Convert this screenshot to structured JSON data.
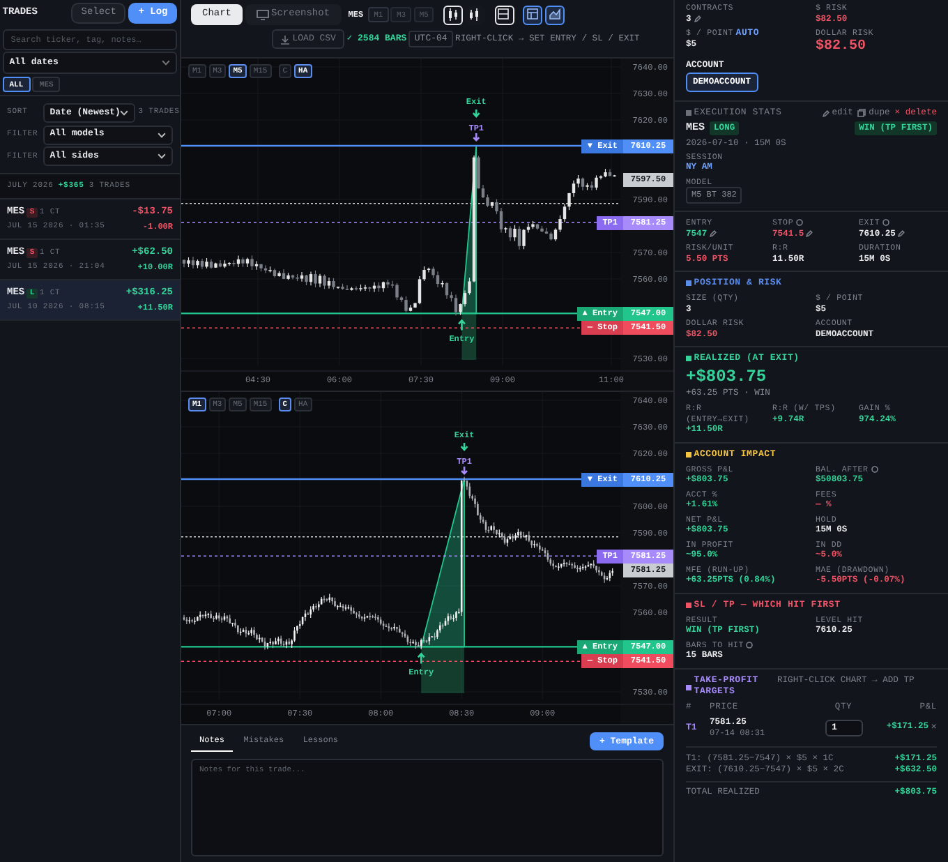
{
  "sidebar": {
    "title": "TRADES",
    "select_button": "Select",
    "log_button": "+ Log",
    "search": {
      "placeholder": "Search ticker, tag, notes…"
    },
    "date_filter": "All dates",
    "symbol_chips": [
      {
        "label": "ALL",
        "selected": true
      },
      {
        "label": "MES",
        "selected": false
      }
    ],
    "sort": {
      "label": "SORT",
      "value": "Date (Newest)",
      "count": "3 TRADES"
    },
    "filters": [
      {
        "label": "FILTER",
        "value": "All models"
      },
      {
        "label": "FILTER",
        "value": "All sides"
      }
    ],
    "group": {
      "month": "JULY 2026",
      "pnl": "+$365",
      "count": "3 TRADES"
    },
    "trades": [
      {
        "symbol": "MES",
        "side": "S",
        "kind": "short",
        "size": "1 CT",
        "pnl": "-$13.75",
        "date": "JUL 15 2026 · 01:35",
        "r": "-1.00R",
        "profit": false,
        "selected": false
      },
      {
        "symbol": "MES",
        "side": "S",
        "kind": "short",
        "size": "1 CT",
        "pnl": "+$62.50",
        "date": "JUL 15 2026 · 21:04",
        "r": "+10.00R",
        "profit": true,
        "selected": false
      },
      {
        "symbol": "MES",
        "side": "L",
        "kind": "long",
        "size": "1 CT",
        "pnl": "+$316.25",
        "date": "JUL 10 2026 · 08:15",
        "r": "+11.50R",
        "profit": true,
        "selected": true
      }
    ]
  },
  "toolbar": {
    "view_tabs": [
      {
        "label": "Chart",
        "kind": "text",
        "selected": true
      },
      {
        "label": "Screenshot",
        "kind": "screenshot",
        "selected": false
      }
    ],
    "symbol": "MES",
    "timeframes": [
      {
        "label": "M1",
        "disabled": false
      },
      {
        "label": "M3",
        "disabled": true
      },
      {
        "label": "M5",
        "disabled": true
      }
    ],
    "tool_buttons": [
      {
        "kind": "candles",
        "selected": true
      },
      {
        "kind": "bars",
        "selected": false
      },
      {
        "kind": "split",
        "selected": true
      },
      {
        "kind": "table",
        "selected": true
      },
      {
        "kind": "area",
        "selected": true
      }
    ],
    "load_button": "LOAD CSV",
    "bars_status": "✓ 2584 BARS",
    "timezone": "UTC-04",
    "hint": "RIGHT-CLICK → SET ENTRY / SL / EXIT"
  },
  "charts": [
    {
      "timeframes": [
        {
          "label": "M1",
          "selected": false
        },
        {
          "label": "M3",
          "selected": false
        },
        {
          "label": "M5",
          "selected": true
        },
        {
          "label": "M15",
          "selected": false
        }
      ],
      "modes": [
        {
          "label": "C",
          "selected": false
        },
        {
          "label": "HA",
          "selected": true
        }
      ],
      "price_ticks": [
        "7640.00",
        "7630.00",
        "7620.00",
        "7590.00",
        "7570.00",
        "7560.00",
        "7530.00"
      ],
      "time_ticks": [
        "04:30",
        "06:00",
        "07:30",
        "09:00",
        "11:00"
      ],
      "levels": [
        {
          "kind": "exit",
          "label": "▼ Exit",
          "price": "7610.25"
        },
        {
          "kind": "tp",
          "label": "TP1",
          "price": "7581.25"
        },
        {
          "kind": "entry",
          "label": "▲ Entry",
          "price": "7547.00"
        },
        {
          "kind": "stop",
          "label": "— Stop",
          "price": "7541.50"
        }
      ],
      "last_price": "7597.50",
      "markers": [
        {
          "kind": "exit",
          "label": "Exit"
        },
        {
          "kind": "tp",
          "label": "TP1"
        },
        {
          "kind": "entry",
          "label": "Entry"
        }
      ]
    },
    {
      "timeframes": [
        {
          "label": "M1",
          "selected": true
        },
        {
          "label": "M3",
          "selected": false
        },
        {
          "label": "M5",
          "selected": false
        },
        {
          "label": "M15",
          "selected": false
        }
      ],
      "modes": [
        {
          "label": "C",
          "selected": true
        },
        {
          "label": "HA",
          "selected": false
        }
      ],
      "price_ticks": [
        "7640.00",
        "7630.00",
        "7620.00",
        "7600.00",
        "7590.00",
        "7570.00",
        "7560.00",
        "7530.00"
      ],
      "time_ticks": [
        "07:00",
        "07:30",
        "08:00",
        "08:30",
        "09:00"
      ],
      "levels": [
        {
          "kind": "exit",
          "label": "▼ Exit",
          "price": "7610.25"
        },
        {
          "kind": "tp",
          "label": "TP1",
          "price": "7581.25"
        },
        {
          "kind": "entry",
          "label": "▲ Entry",
          "price": "7547.00"
        },
        {
          "kind": "stop",
          "label": "— Stop",
          "price": "7541.50"
        }
      ],
      "last_price": "7581.25",
      "markers": [
        {
          "kind": "exit",
          "label": "Exit"
        },
        {
          "kind": "tp",
          "label": "TP1"
        },
        {
          "kind": "entry",
          "label": "Entry"
        }
      ]
    }
  ],
  "notes": {
    "tabs": [
      {
        "label": "Notes",
        "selected": true
      },
      {
        "label": "Mistakes",
        "selected": false
      },
      {
        "label": "Lessons",
        "selected": false
      }
    ],
    "template_button": "+ Template",
    "placeholder": "Notes for this trade..."
  },
  "risk": {
    "fields": [
      {
        "label": "CONTRACTS",
        "value": "3",
        "kind": "plain",
        "editable": true
      },
      {
        "label": "$ RISK",
        "value": "$82.50",
        "kind": "loss"
      },
      {
        "label": "$ / POINT",
        "tag": "AUTO",
        "value": "$5",
        "kind": "plain"
      },
      {
        "label": "DOLLAR RISK",
        "value": "$82.50",
        "kind": "loss",
        "emphasis": true
      }
    ],
    "account_label": "ACCOUNT",
    "account": "DEMOACCOUNT"
  },
  "execution": {
    "title": "EXECUTION STATS",
    "color": "#6b7079",
    "actions": [
      {
        "kind": "edit",
        "label": "edit"
      },
      {
        "kind": "dupe",
        "label": "dupe"
      },
      {
        "kind": "delete",
        "label": "× delete"
      }
    ],
    "symbol": "MES",
    "direction": "LONG",
    "outcome": "WIN (TP FIRST)",
    "date": "2026-07-10 · 15M 0S",
    "session_label": "SESSION",
    "session": "NY AM",
    "model_label": "MODEL",
    "model": "M5 BT 382",
    "fields": [
      {
        "label": "ENTRY",
        "value": "7547",
        "kind": "gain",
        "editable": true
      },
      {
        "label": "STOP",
        "info": true,
        "value": "7541.5",
        "kind": "loss",
        "editable": true
      },
      {
        "label": "EXIT",
        "info": true,
        "value": "7610.25",
        "kind": "plain",
        "editable": true
      },
      {
        "label": "RISK/UNIT",
        "value": "5.50 PTS",
        "kind": "loss"
      },
      {
        "label": "R:R",
        "value": "11.50R",
        "kind": "plain"
      },
      {
        "label": "DURATION",
        "value": "15M 0S",
        "kind": "plain"
      }
    ]
  },
  "sections": [
    {
      "title": "POSITION & RISK",
      "color": "#5b8def",
      "fields": [
        {
          "label": "SIZE (QTY)",
          "value": "3",
          "kind": "plain"
        },
        {
          "label": "$ / POINT",
          "value": "$5",
          "kind": "plain"
        },
        {
          "label": "DOLLAR RISK",
          "value": "$82.50",
          "kind": "loss"
        },
        {
          "label": "ACCOUNT",
          "value": "DEMOACCOUNT",
          "kind": "plain"
        }
      ]
    },
    {
      "title": "REALIZED (AT EXIT)",
      "color": "#34d399",
      "headline": "+$803.75",
      "subline": "+63.25 PTS · WIN",
      "fields": [
        {
          "label": "R:R (ENTRY→EXIT)",
          "value": "+11.50R",
          "kind": "gain"
        },
        {
          "label": "R:R (W/ TPS)",
          "value": "+9.74R",
          "kind": "gain"
        },
        {
          "label": "GAIN %",
          "value": "974.24%",
          "kind": "gain"
        }
      ]
    },
    {
      "title": "ACCOUNT IMPACT",
      "color": "#f5c542",
      "fields": [
        {
          "label": "GROSS P&L",
          "value": "+$803.75",
          "kind": "gain"
        },
        {
          "label": "BAL. AFTER",
          "info": true,
          "value": "$50803.75",
          "kind": "gain"
        },
        {
          "label": "ACCT %",
          "value": "+1.61%",
          "kind": "gain"
        },
        {
          "label": "FEES",
          "value": "— %",
          "kind": "loss"
        },
        {
          "label": "NET P&L",
          "value": "+$803.75",
          "kind": "gain"
        },
        {
          "label": "HOLD",
          "value": "15M 0S",
          "kind": "plain"
        },
        {
          "label": "IN PROFIT",
          "value": "~95.0%",
          "kind": "gain"
        },
        {
          "label": "IN DD",
          "value": "~5.0%",
          "kind": "loss"
        },
        {
          "label": "MFE (RUN-UP)",
          "value": "+63.25PTS (0.84%)",
          "kind": "gain"
        },
        {
          "label": "MAE (DRAWDOWN)",
          "value": "-5.50PTS (-0.07%)",
          "kind": "loss"
        }
      ]
    },
    {
      "title": "SL / TP — WHICH HIT FIRST",
      "color": "#f05365",
      "fields": [
        {
          "label": "RESULT",
          "value": "WIN (TP FIRST)",
          "kind": "gain"
        },
        {
          "label": "LEVEL HIT",
          "value": "7610.25",
          "kind": "plain"
        },
        {
          "label": "BARS TO HIT",
          "info": true,
          "value": "15 BARS",
          "kind": "plain"
        }
      ]
    }
  ],
  "targets": {
    "title": "TAKE-PROFIT TARGETS",
    "color": "#a78bfa",
    "hint": "RIGHT-CLICK CHART → ADD TP",
    "columns": [
      "#",
      "PRICE",
      "QTY",
      "P&L"
    ],
    "rows": [
      {
        "id": "T1",
        "price": "7581.25",
        "time": "07-14 08:31",
        "qty": "1",
        "pnl": "+$171.25",
        "remove": "×"
      }
    ],
    "breakdown": [
      {
        "formula": "T1: (7581.25−7547) × $5 × 1C",
        "amount": "+$171.25"
      },
      {
        "formula": "EXIT: (7610.25−7547) × $5 × 2C",
        "amount": "+$632.50"
      }
    ],
    "total_label": "TOTAL REALIZED",
    "total": "+$803.75"
  }
}
